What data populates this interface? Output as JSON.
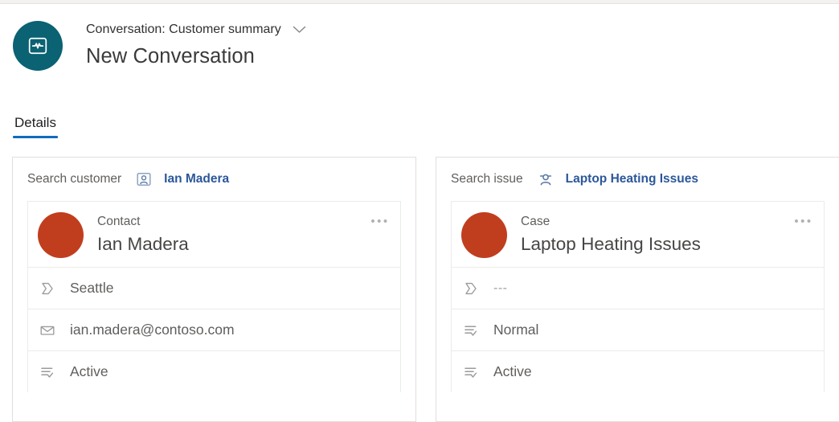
{
  "header": {
    "avatar_icon": "conversation-icon",
    "avatar_color": "#0a6273",
    "breadcrumb": "Conversation: Customer summary",
    "chevron_icon": "chevron-down-icon",
    "title": "New Conversation"
  },
  "tabs": [
    {
      "label": "Details",
      "active": true
    }
  ],
  "accent_color": "#0f6cbd",
  "link_color": "#2b579a",
  "record_avatar_color": "#c03e1e",
  "panels": [
    {
      "search": {
        "label": "Search customer",
        "entity_icon": "contact-card-icon",
        "value": "Ian Madera"
      },
      "record": {
        "type": "Contact",
        "name": "Ian Madera",
        "overflow_label": "•••",
        "attributes": [
          {
            "icon": "tag-icon",
            "value": "Seattle",
            "dim": false
          },
          {
            "icon": "mail-icon",
            "value": "ian.madera@contoso.com",
            "dim": false
          },
          {
            "icon": "status-list-icon",
            "value": "Active",
            "dim": false
          }
        ]
      }
    },
    {
      "search": {
        "label": "Search issue",
        "entity_icon": "case-agent-icon",
        "value": "Laptop Heating Issues"
      },
      "record": {
        "type": "Case",
        "name": "Laptop Heating Issues",
        "overflow_label": "•••",
        "attributes": [
          {
            "icon": "tag-icon",
            "value": "---",
            "dim": true
          },
          {
            "icon": "status-list-icon",
            "value": "Normal",
            "dim": false
          },
          {
            "icon": "status-list-icon",
            "value": "Active",
            "dim": false
          }
        ]
      }
    }
  ]
}
